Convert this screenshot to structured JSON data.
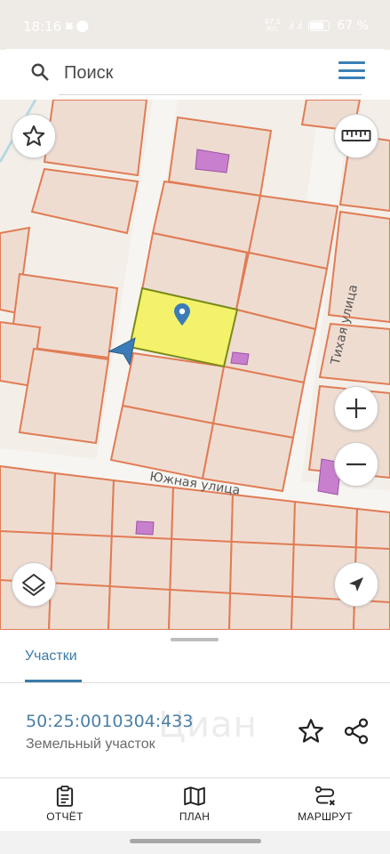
{
  "status_bar": {
    "time": "18:16",
    "network_top": "87,5",
    "network_bottom": "К/с",
    "battery": "67 %"
  },
  "search": {
    "placeholder": "Поиск"
  },
  "map": {
    "streets": {
      "tikhaya": "Тихая улица",
      "yuzhnaya": "Южная улица"
    },
    "colors": {
      "background": "#f3efe8",
      "parcel_fill": "#efdcd1",
      "parcel_border": "#e07c55",
      "selected_fill": "#f3f26a",
      "selected_border": "#7a8a1a",
      "building": "#c77fce",
      "pin": "#3b7bb7"
    }
  },
  "sheet": {
    "tab_label": "Участки",
    "parcel": {
      "cadastral_number": "50:25:0010304:433",
      "type": "Земельный участок"
    },
    "watermark": "Циан"
  },
  "nav": {
    "report": "ОТЧЁТ",
    "plan": "ПЛАН",
    "route": "МАРШРУТ"
  }
}
